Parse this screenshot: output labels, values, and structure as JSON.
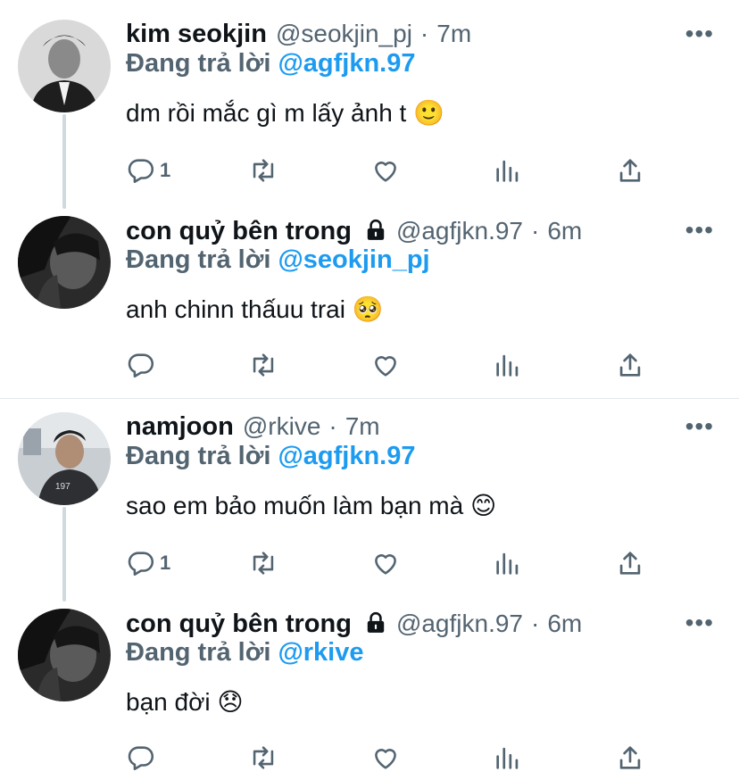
{
  "tweets": [
    {
      "name": "kim seokjin",
      "locked": false,
      "handle": "@seokjin_pj",
      "time": "7m",
      "dot": "·",
      "reply_prefix": "Đang trả lời",
      "reply_target": "@agfjkn.97",
      "text": "dm rồi mắc gì m lấy ảnh t 🙂",
      "reply_count": "1",
      "more": "•••"
    },
    {
      "name": "con quỷ bên trong",
      "locked": true,
      "handle": "@agfjkn.97",
      "time": "6m",
      "dot": "·",
      "reply_prefix": "Đang trả lời",
      "reply_target": "@seokjin_pj",
      "text": "anh chinn thấuu trai 🥺",
      "reply_count": "",
      "more": "•••"
    },
    {
      "name": "namjoon",
      "locked": false,
      "handle": "@rkive",
      "time": "7m",
      "dot": "·",
      "reply_prefix": "Đang trả lời",
      "reply_target": "@agfjkn.97",
      "text": "sao em bảo muốn làm bạn mà 😊",
      "reply_count": "1",
      "more": "•••"
    },
    {
      "name": "con quỷ bên trong",
      "locked": true,
      "handle": "@agfjkn.97",
      "time": "6m",
      "dot": "·",
      "reply_prefix": "Đang trả lời",
      "reply_target": "@rkive",
      "text": "bạn đời 😞",
      "reply_count": "",
      "more": "•••"
    }
  ],
  "icons": {
    "reply": "speech-bubble-icon",
    "retweet": "retweet-icon",
    "like": "heart-icon",
    "views": "bar-chart-icon",
    "share": "share-upload-icon",
    "lock": "lock-icon",
    "more": "more-options-icon"
  },
  "colors": {
    "link": "#1d9bf0",
    "muted": "#536471",
    "text": "#0f1419",
    "thread_line": "#cfd9de"
  }
}
